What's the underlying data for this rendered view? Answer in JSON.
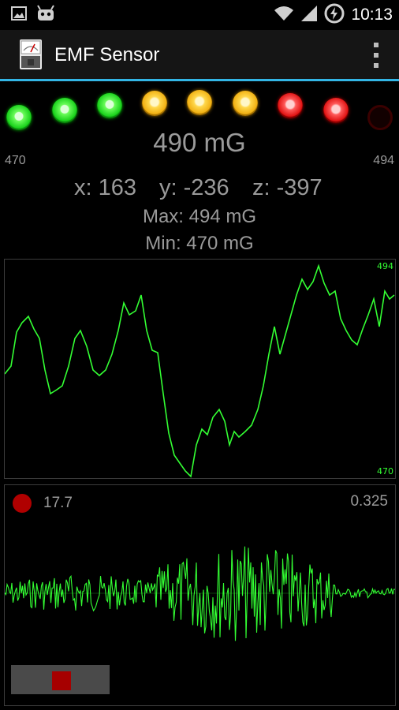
{
  "statusbar": {
    "time": "10:13",
    "icons": [
      "image-icon",
      "android-icon",
      "wifi-icon",
      "signal-icon",
      "battery-icon"
    ]
  },
  "actionbar": {
    "title": "EMF Sensor",
    "icons": [
      "emf-meter-icon",
      "overflow-menu-icon"
    ],
    "accent": "#33b5e5"
  },
  "meter": {
    "leds": [
      "green",
      "green",
      "green",
      "yellow",
      "yellow",
      "yellow",
      "red",
      "red",
      "off"
    ],
    "min_label": "470",
    "max_label": "494",
    "reading": "490 mG",
    "x_text": "x: 163",
    "y_text": "y: -236",
    "z_text": "z: -397",
    "max_text": "Max: 494 mG",
    "min_text": "Min: 470 mG"
  },
  "graph": {
    "top_label": "494",
    "bottom_label": "470",
    "color": "#33ff33"
  },
  "recorder": {
    "left_value": "17.7",
    "right_value": "0.325",
    "dot_color": "#b00000",
    "stop_icon": "stop-icon"
  }
}
